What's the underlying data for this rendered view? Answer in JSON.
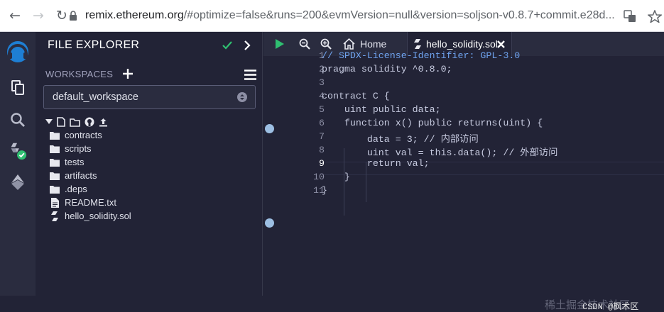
{
  "browser": {
    "url_host": "remix.ethereum.org",
    "url_rest": "/#optimize=false&runs=200&evmVersion=null&version=soljson-v0.8.7+commit.e28d..."
  },
  "panel": {
    "title": "FILE EXPLORER",
    "workspaces_label": "WORKSPACES",
    "workspace_selected": "default_workspace",
    "tree": [
      {
        "type": "folder",
        "label": "contracts"
      },
      {
        "type": "folder",
        "label": "scripts"
      },
      {
        "type": "folder",
        "label": "tests"
      },
      {
        "type": "folder",
        "label": "artifacts"
      },
      {
        "type": "folder",
        "label": ".deps"
      },
      {
        "type": "file",
        "label": "README.txt"
      },
      {
        "type": "sol",
        "label": "hello_solidity.sol"
      }
    ]
  },
  "editor": {
    "home_tab": "Home",
    "file_tab": "hello_solidity.sol",
    "line_numbers": [
      "1",
      "2",
      "3",
      "4",
      "5",
      "6",
      "7",
      "8",
      "9",
      "10",
      "11"
    ],
    "lines": [
      "// SPDX-License-Identifier: GPL-3.0",
      "pragma solidity ^0.8.0;",
      "",
      "contract C {",
      "    uint public data;",
      "    function x() public returns(uint) {",
      "        data = 3; // 内部访问",
      "        uint val = this.data(); // 外部访问",
      "        return val;",
      "    }",
      "}"
    ],
    "current_line": "9"
  },
  "watermark": "稀土掘金技术社区",
  "csdn_mark": "CSDN @枫术区"
}
